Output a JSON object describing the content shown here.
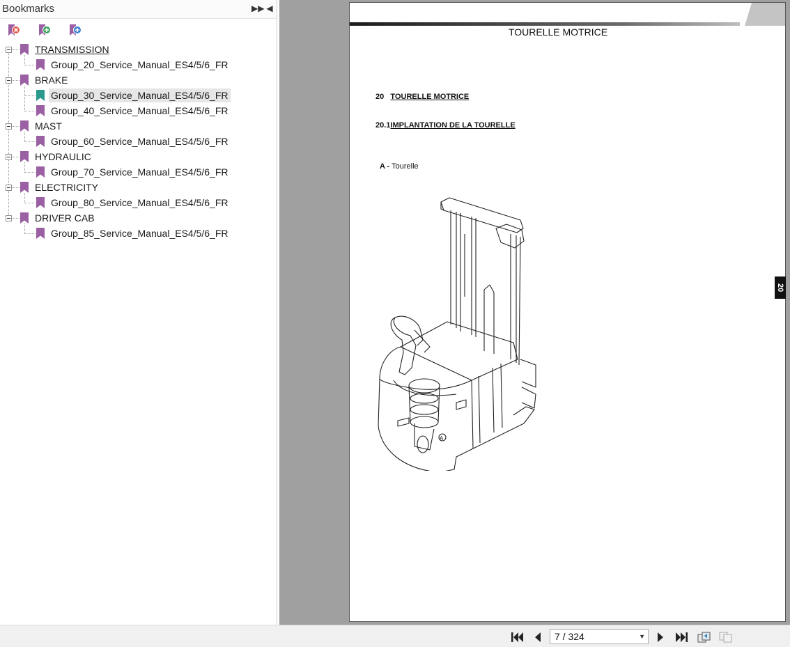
{
  "bookmarks_panel": {
    "title": "Bookmarks",
    "expand_icon": "double-chevron-right-icon",
    "collapse_icon": "triangle-left-icon",
    "toolbar": [
      {
        "name": "delete-bookmark-button",
        "icon": "bookmark-delete-icon",
        "accent": "#e05a4a"
      },
      {
        "name": "add-bookmark-button",
        "icon": "bookmark-add-icon",
        "accent": "#3aa35a"
      },
      {
        "name": "add-child-bookmark-button",
        "icon": "bookmark-add-child-icon",
        "accent": "#3b7fd0"
      }
    ],
    "items": [
      {
        "label": "TRANSMISSION",
        "children": [
          {
            "label": "Group_20_Service_Manual_ES4/5/6_FR"
          }
        ]
      },
      {
        "label": "BRAKE",
        "children": [
          {
            "label": "Group_30_Service_Manual_ES4/5/6_FR",
            "selected": true
          },
          {
            "label": "Group_40_Service_Manual_ES4/5/6_FR"
          }
        ]
      },
      {
        "label": "MAST",
        "children": [
          {
            "label": "Group_60_Service_Manual_ES4/5/6_FR"
          }
        ]
      },
      {
        "label": "HYDRAULIC",
        "children": [
          {
            "label": "Group_70_Service_Manual_ES4/5/6_FR"
          }
        ]
      },
      {
        "label": "ELECTRICITY",
        "children": [
          {
            "label": "Group_80_Service_Manual_ES4/5/6_FR"
          }
        ]
      },
      {
        "label": "DRIVER CAB",
        "children": [
          {
            "label": "Group_85_Service_Manual_ES4/5/6_FR"
          }
        ]
      }
    ],
    "colors": {
      "bookmark": "#9b5fa3",
      "bookmark_selected": "#2a9a8e",
      "selection_bg": "#e6e6e6"
    }
  },
  "page": {
    "header": "TOURELLE MOTRICE",
    "section1_number": "20",
    "section1_title": "TOURELLE MOTRICE",
    "section2_number": "20.1",
    "section2_title": "IMPLANTATION DE LA TOURELLE",
    "figure_key": "A -",
    "figure_caption": "Tourelle",
    "figure_callout": "A",
    "side_tab": "20"
  },
  "nav": {
    "page_indicator": "7 / 324",
    "buttons": [
      "first-page-icon",
      "previous-page-icon",
      "next-page-icon",
      "last-page-icon",
      "previous-view-icon",
      "next-view-icon"
    ]
  }
}
